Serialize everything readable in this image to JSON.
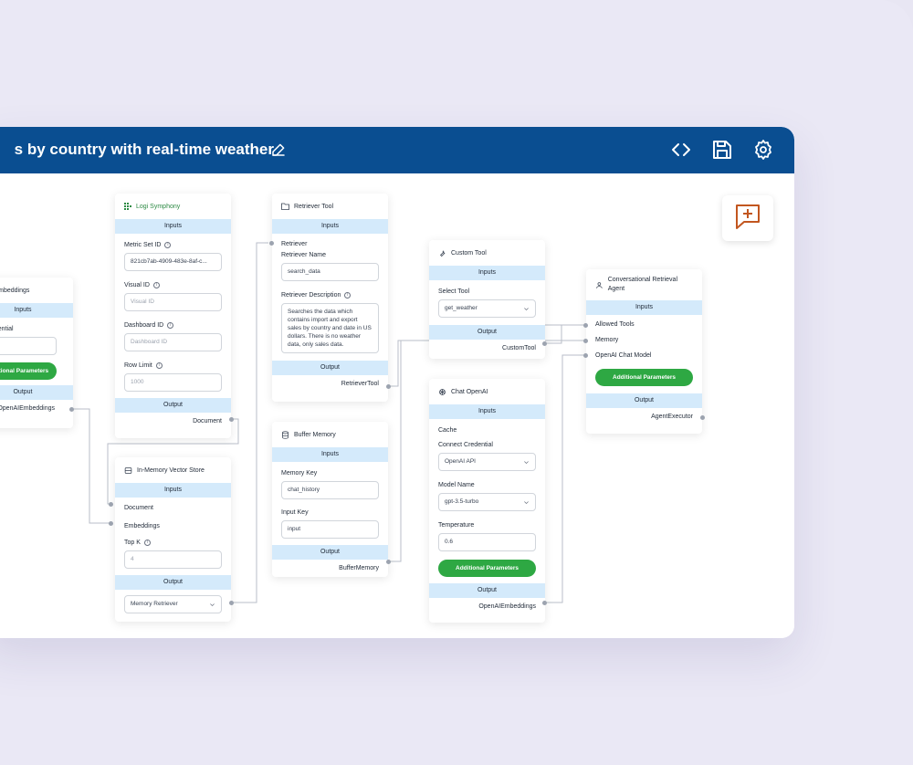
{
  "header": {
    "title": "s by country with real-time weather"
  },
  "nodes": {
    "embeddings": {
      "title": "l Embeddings",
      "inputs_label": "Inputs",
      "credential_label": "edential",
      "credential_value": "PI",
      "button": "ditional Parameters",
      "output_label": "Output",
      "output": "OpenAIEmbeddings"
    },
    "logi": {
      "title": "Logi Symphony",
      "inputs_label": "Inputs",
      "metric_label": "Metric Set ID",
      "metric_value": "821cb7ab-4909-483e-8af-c...",
      "visual_label": "Visual ID",
      "visual_placeholder": "Visual ID",
      "dashboard_label": "Dashboard ID",
      "dashboard_placeholder": "Dashboard ID",
      "row_label": "Row Limit",
      "row_placeholder": "1000",
      "output_label": "Output",
      "output": "Document"
    },
    "retriever": {
      "title": "Retriever Tool",
      "inputs_label": "Inputs",
      "retriever_label": "Retriever",
      "name_label": "Retriever Name",
      "name_value": "search_data",
      "desc_label": "Retriever Description",
      "desc_value": "Searches the data which contains import and export sales by country and date in US dollars. There is no weather data, only sales data.",
      "output_label": "Output",
      "output": "RetrieverTool"
    },
    "custom": {
      "title": "Custom Tool",
      "inputs_label": "Inputs",
      "select_label": "Select Tool",
      "select_value": "get_weather",
      "output_label": "Output",
      "output": "CustomTool"
    },
    "agent": {
      "title": "Conversational Retrieval Agent",
      "inputs_label": "Inputs",
      "allowed": "Allowed Tools",
      "memory": "Memory",
      "chatmodel": "OpenAI Chat Model",
      "button": "Additional Parameters",
      "output_label": "Output",
      "output": "AgentExecutor"
    },
    "vector": {
      "title": "In-Memory Vector Store",
      "inputs_label": "Inputs",
      "document": "Document",
      "embeddings": "Embeddings",
      "topk_label": "Top K",
      "topk_placeholder": "4",
      "output_label": "Output",
      "output_select": "Memory Retriever"
    },
    "buffer": {
      "title": "Buffer Memory",
      "inputs_label": "Inputs",
      "key_label": "Memory Key",
      "key_value": "chat_history",
      "input_label": "Input Key",
      "input_value": "input",
      "output_label": "Output",
      "output": "BufferMemory"
    },
    "chat": {
      "title": "Chat OpenAI",
      "inputs_label": "Inputs",
      "cache": "Cache",
      "cred_label": "Connect Credential",
      "cred_value": "OpenAI API",
      "model_label": "Model Name",
      "model_value": "gpt-3.5-turbo",
      "temp_label": "Temperature",
      "temp_value": "0.6",
      "button": "Additional Parameters",
      "output_label": "Output",
      "output": "OpenAIEmbeddings"
    }
  },
  "colors": {
    "header": "#0a4e91",
    "section": "#d4eafb",
    "button": "#2ea843",
    "chat_icon": "#c2561f"
  },
  "icons": [
    "edit-icon",
    "code-icon",
    "save-icon",
    "settings-icon",
    "chat-add-icon"
  ]
}
